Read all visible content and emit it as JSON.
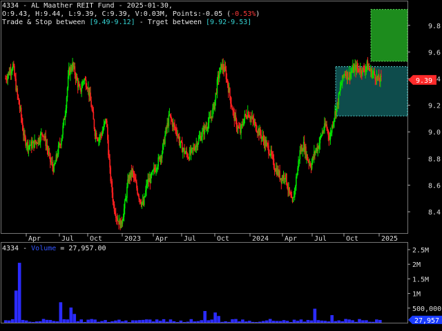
{
  "header": {
    "symbol": "4334",
    "name_sep": " - ",
    "name": "AL Maather REIT Fund",
    "date_sep": " - ",
    "date": "2025-01-30,",
    "ohlc": "O:9.43, H:9.44, L:9.39, C:9.39, V:0.03M, Points:-0.05 (",
    "change_pct": "-0.53%",
    "close_paren": ")",
    "trade_stop_label": "Trade & Stop between ",
    "trade_stop_range": "[9.49-9.12]",
    "target_label": " - Trget between ",
    "target_range": "[9.92-9.53]"
  },
  "colors": {
    "background": "#000000",
    "bull": "#00e000",
    "bear": "#ff2020",
    "trade_zone": "#0e4c4c",
    "target_zone": "#1d8c1d",
    "price_tag": "#ff2a2a",
    "volume": "#2b2bff",
    "volume_tag": "#1a3cff"
  },
  "price_tag": "9.39",
  "volume_tag": "27,957",
  "volume_panel": {
    "symbol": "4334",
    "sep": " - ",
    "label": "Volume",
    "value_text": " = 27,957.00"
  },
  "chart_data": {
    "type": "candlestick",
    "x_ticks": [
      "Apr",
      "Jul",
      "Oct",
      "2023",
      "Apr",
      "Jul",
      "Oct",
      "2024",
      "Apr",
      "Jul",
      "Oct",
      "2025"
    ],
    "y_ticks": [
      "9.8",
      "9.6",
      "9.4",
      "9.2",
      "9.0",
      "8.8",
      "8.6",
      "8.4"
    ],
    "ylim": [
      8.24,
      9.98
    ],
    "volume_ticks": [
      "2.5M",
      "2M",
      "1.5M",
      "1M",
      "500,000"
    ],
    "volume_ylim": [
      0,
      2500000
    ],
    "last_close": 9.39,
    "last_volume": 27957,
    "trade_stop_zone": [
      9.12,
      9.49
    ],
    "target_zone": [
      9.53,
      9.92
    ],
    "close_series": [
      9.4,
      9.45,
      9.5,
      9.3,
      9.15,
      8.95,
      8.9,
      8.9,
      8.92,
      8.95,
      9.0,
      8.9,
      8.78,
      8.72,
      8.85,
      8.95,
      9.15,
      9.45,
      9.5,
      9.4,
      9.3,
      9.4,
      9.35,
      9.2,
      9.0,
      8.95,
      9.0,
      9.1,
      8.7,
      8.45,
      8.35,
      8.3,
      8.45,
      8.65,
      8.7,
      8.6,
      8.5,
      8.45,
      8.62,
      8.65,
      8.72,
      8.78,
      8.85,
      9.0,
      9.12,
      9.05,
      9.0,
      8.9,
      8.85,
      8.82,
      8.85,
      8.9,
      8.95,
      9.0,
      9.05,
      9.1,
      9.2,
      9.4,
      9.5,
      9.45,
      9.3,
      9.15,
      9.05,
      9.0,
      9.1,
      9.15,
      9.1,
      9.05,
      9.0,
      8.95,
      8.9,
      8.85,
      8.75,
      8.7,
      8.65,
      8.68,
      8.55,
      8.45,
      8.65,
      8.85,
      8.9,
      8.8,
      8.75,
      8.85,
      8.9,
      9.0,
      9.05,
      8.95,
      9.1,
      9.2,
      9.35,
      9.45,
      9.42,
      9.46,
      9.48,
      9.47,
      9.46,
      9.5,
      9.45,
      9.43,
      9.39
    ]
  }
}
